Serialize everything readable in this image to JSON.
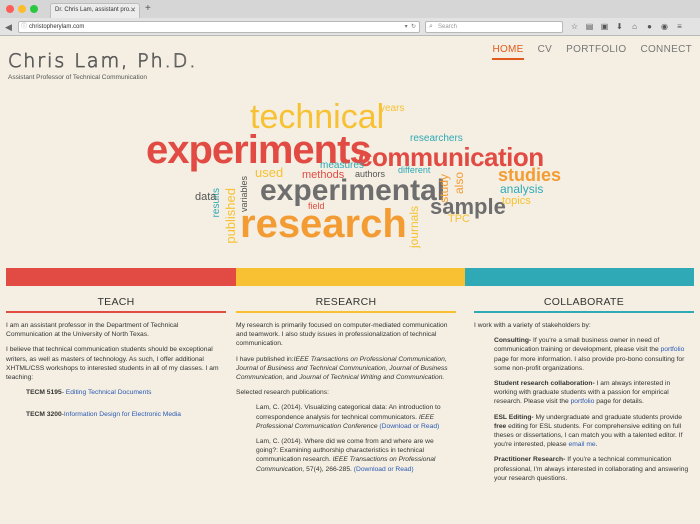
{
  "browser": {
    "tab_title": "Dr. Chris Lam, assistant pro...",
    "url": "christopherylam.com",
    "search_placeholder": "Search"
  },
  "site": {
    "title": "Chris Lam, Ph.D.",
    "subtitle": "Assistant Professor of Technical Communication"
  },
  "nav": [
    "HOME",
    "CV",
    "PORTFOLIO",
    "CONNECT"
  ],
  "colors": {
    "accent": "#e05a1b",
    "red": "#e24b43",
    "yellow": "#f7c133",
    "teal": "#2fa9b6",
    "link": "#2a58b5"
  },
  "cloud_words": [
    {
      "text": "technical",
      "color": "#f7c133"
    },
    {
      "text": "experiments",
      "color": "#e24b43"
    },
    {
      "text": "communication",
      "color": "#e24b43"
    },
    {
      "text": "experimental",
      "color": "#7a7a7a"
    },
    {
      "text": "research",
      "color": "#f39c34"
    },
    {
      "text": "sample",
      "color": "#7a7a7a"
    },
    {
      "text": "studies",
      "color": "#f39c34"
    },
    {
      "text": "analysis",
      "color": "#2fa9b6"
    },
    {
      "text": "published",
      "color": "#f7c133"
    },
    {
      "text": "data",
      "color": "#555"
    },
    {
      "text": "researchers",
      "color": "#2fa9b6"
    },
    {
      "text": "journals",
      "color": "#f7c133"
    },
    {
      "text": "study",
      "color": "#f39c34"
    },
    {
      "text": "also",
      "color": "#f39c34"
    },
    {
      "text": "methods",
      "color": "#e24b43"
    },
    {
      "text": "used",
      "color": "#f7c133"
    },
    {
      "text": "results",
      "color": "#2fa9b6"
    },
    {
      "text": "TPC",
      "color": "#f7c133"
    },
    {
      "text": "topics",
      "color": "#f7c133"
    },
    {
      "text": "field",
      "color": "#e24b43"
    },
    {
      "text": "authors",
      "color": "#555"
    },
    {
      "text": "measures",
      "color": "#2fa9b6"
    },
    {
      "text": "different",
      "color": "#2fa9b6"
    },
    {
      "text": "years",
      "color": "#f7c133"
    },
    {
      "text": "variables",
      "color": "#555"
    }
  ],
  "teach": {
    "heading": "TEACH",
    "p1": "I am an assistant professor in the Department of Technical Communication at the University of North Texas.",
    "p2": "I believe that technical communication students should be exceptional writers, as well as masters of technology. As such, I offer additional XHTML/CSS workshops to interested students in all of my classes. I am teaching:",
    "courses": [
      {
        "code": "TECM 5195",
        "sep": "- ",
        "name": "Editing Technical Documents"
      },
      {
        "code": "TECM 3200",
        "sep": "-",
        "name": "Information Design for Electronic Media"
      }
    ]
  },
  "research": {
    "heading": "RESEARCH",
    "p1": "My research is primarily focused on computer-mediated communication and teamwork. I also study issues in professionalization of technical communication.",
    "p2_prefix": "I have published in:",
    "p2_journals": "IEEE Transactions on Professional Communication, Journal of Business and Technical Communication, Journal of Business Communication,",
    "p2_and": " and ",
    "p2_last": "Journal of Technical Writing and Communication.",
    "selected": "Selected research publications:",
    "pubs": [
      {
        "text": "Lam, C. (2014). Visualizing categorical data: An introduction to correspondence analysis for technical communicators. ",
        "venue": "IEEE Professional Communication Conference",
        "link": "(Download or Read)"
      },
      {
        "text": "Lam, C. (2014). Where did we come from and where are we going?: Examining authorship characteristics in technical communication research. ",
        "venue": "IEEE Transactions on Professional Communication,",
        "tail": " 57(4), 266-285. ",
        "link": "(Download or Read)"
      }
    ]
  },
  "collaborate": {
    "heading": "COLLABORATE",
    "intro": "I work with a variety of stakeholders by:",
    "consulting_label": "Consulting-",
    "consulting_a": " If you're a small business owner in need of communication training or development, please visit the ",
    "consulting_link": "portfolio",
    "consulting_b": " page for more information. I also provide pro-bono consulting for some non-profit organizations.",
    "student_label": "Student research collaboration-",
    "student_a": " I am always interested in working with graduate students with a passion for empirical research. Please visit the ",
    "student_link": "portfolio",
    "student_b": " page for details.",
    "esl_label": "ESL Editing-",
    "esl_a": " My undergraduate and graduate students provide ",
    "esl_free": "free",
    "esl_b": " editing for ESL students. For comprehensive editing on full theses or dissertations, I can match you with a talented editor. If you're interested, please ",
    "esl_link": "email me",
    "esl_c": ".",
    "pract_label": "Practitioner Research-",
    "pract_a": " If you're a technical communication professional, I'm always interested in collaborating and answering your research questions."
  }
}
